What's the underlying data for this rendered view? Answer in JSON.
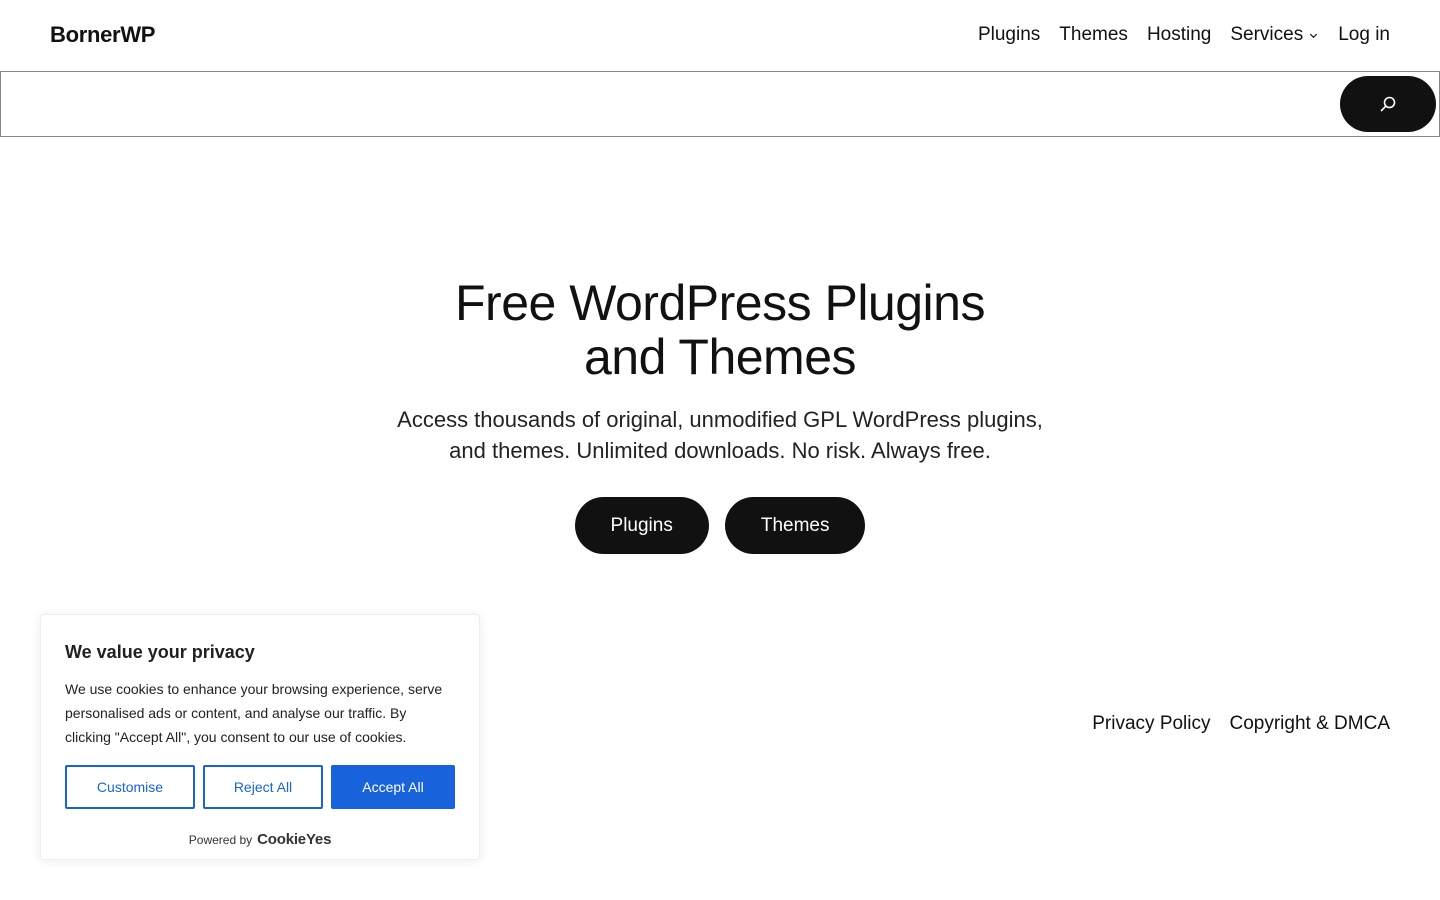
{
  "header": {
    "logo": "BornerWP",
    "nav": [
      {
        "label": "Plugins"
      },
      {
        "label": "Themes"
      },
      {
        "label": "Hosting"
      },
      {
        "label": "Services"
      },
      {
        "label": "Log in"
      }
    ]
  },
  "search": {
    "placeholder": "",
    "value": "",
    "button_icon": "search-icon"
  },
  "hero": {
    "title_line1": "Free WordPress Plugins",
    "title_line2": "and Themes",
    "subtitle_line1": "Access thousands of original, unmodified GPL WordPress plugins,",
    "subtitle_line2": "and themes. Unlimited downloads. No risk. Always free.",
    "buttons": [
      {
        "label": "Plugins"
      },
      {
        "label": "Themes"
      }
    ]
  },
  "footer": {
    "links": [
      {
        "label": "Privacy Policy"
      },
      {
        "label": "Copyright & DMCA"
      }
    ]
  },
  "cookie_banner": {
    "title": "We value your privacy",
    "text": "We use cookies to enhance your browsing experience, serve personalised ads or content, and analyse our traffic. By clicking \"Accept All\", you consent to our use of cookies.",
    "buttons": {
      "customise": "Customise",
      "reject": "Reject All",
      "accept": "Accept All"
    },
    "powered_by": "Powered by",
    "brand": "CookieYes",
    "accent_color": "#1863dc"
  },
  "colors": {
    "primary": "#111111",
    "background": "#ffffff"
  }
}
